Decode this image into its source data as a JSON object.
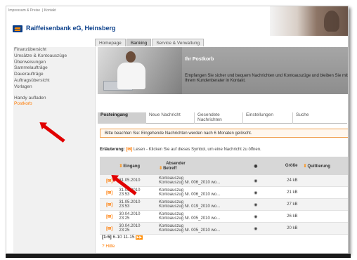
{
  "top_links": [
    "Impressum & Preise",
    "Kontakt"
  ],
  "bank": {
    "name": "Raiffeisenbank eG, Heinsberg"
  },
  "tabs": [
    {
      "label": "Homepage"
    },
    {
      "label": "Banking"
    },
    {
      "label": "Service & Verwaltung"
    }
  ],
  "sidebar": {
    "items_top": [
      "Finanzübersicht",
      "Umsätze & Kontoauszüge",
      "Überweisungen",
      "Sammelaufträge",
      "Daueraufträge",
      "Auftragsübersicht",
      "Vorlagen"
    ],
    "items_bottom": [
      "Handy aufladen",
      "Postkorb"
    ]
  },
  "banner": {
    "title": "Ihr Postkorb",
    "text": "Empfangen Sie sicher und bequem Nachrichten und Kontoauszüge und bleiben Sie mit Ihrem Kundenberater in Kontakt."
  },
  "subtabs": [
    {
      "label": "Posteingang"
    },
    {
      "label": "Neue Nachricht"
    },
    {
      "label": "Gesendete Nachrichten"
    },
    {
      "label": "Einstellungen"
    },
    {
      "label": "Suche"
    }
  ],
  "notice": "Bitte beachten Sie: Eingehende Nachrichten werden nach 6 Monaten gelöscht.",
  "legend": {
    "label": "Erläuterung:",
    "text": "Lesen - Klicken Sie auf dieses Symbol, um eine Nachricht zu öffnen."
  },
  "table": {
    "headers": {
      "eingang": "Eingang",
      "absender": "Absender",
      "betreff": "Betreff",
      "groesse": "Größe",
      "quittierung": "Quittierung"
    },
    "rows": [
      {
        "date": "31.05.2010",
        "time": "",
        "sender": "Kontoauszug",
        "subject": "Kontoauszug Nr. 006_2010 wo...",
        "size": "24 kB"
      },
      {
        "date": "31.05.2010",
        "time": "23:53",
        "sender": "Kontoauszug",
        "subject": "Kontoauszug Nr. 006_2010 wo...",
        "size": "21 kB"
      },
      {
        "date": "31.05.2010",
        "time": "23:53",
        "sender": "Kontoauszug",
        "subject": "Kontoauszug Nr. 019_2010 wo...",
        "size": "27 kB"
      },
      {
        "date": "30.04.2010",
        "time": "23:25",
        "sender": "Kontoauszug",
        "subject": "Kontoauszug Nr. 005_2010 wo...",
        "size": "26 kB"
      },
      {
        "date": "30.04.2010",
        "time": "23:25",
        "sender": "Kontoauszug",
        "subject": "Kontoauszug Nr. 005_2010 wo...",
        "size": "20 kB"
      }
    ]
  },
  "pager": {
    "pages": [
      "[1-5]",
      "6-10",
      "11-15"
    ]
  },
  "help": "? Hilfe",
  "colors": {
    "brand_blue": "#0a3f8a",
    "accent_orange": "#ff7a00",
    "arrow_red": "#e10000"
  }
}
